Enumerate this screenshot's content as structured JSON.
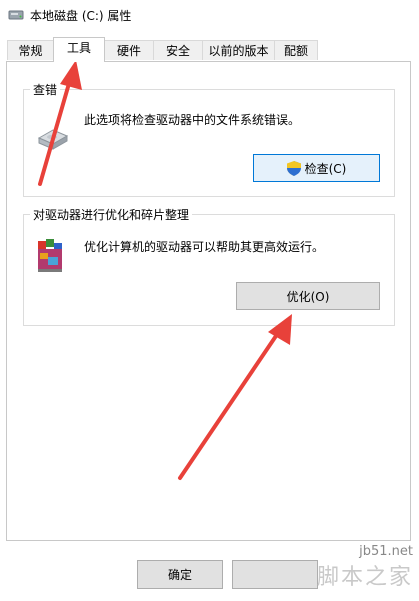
{
  "window": {
    "title": "本地磁盘 (C:) 属性"
  },
  "tabs": [
    {
      "label": "常规",
      "active": false
    },
    {
      "label": "工具",
      "active": true
    },
    {
      "label": "硬件",
      "active": false
    },
    {
      "label": "安全",
      "active": false
    },
    {
      "label": "以前的版本",
      "active": false
    },
    {
      "label": "配额",
      "active": false
    }
  ],
  "error_check": {
    "title": "查错",
    "description": "此选项将检查驱动器中的文件系统错误。",
    "button_label": "检查(C)"
  },
  "optimize": {
    "title": "对驱动器进行优化和碎片整理",
    "description": "优化计算机的驱动器可以帮助其更高效运行。",
    "button_label": "优化(O)"
  },
  "footer": {
    "ok_label": "确定",
    "cancel_label": ""
  },
  "watermark": {
    "url": "jb51.net",
    "brand": "脚本之家"
  },
  "colors": {
    "arrow": "#e8413a",
    "focus_border": "#0078d7"
  }
}
